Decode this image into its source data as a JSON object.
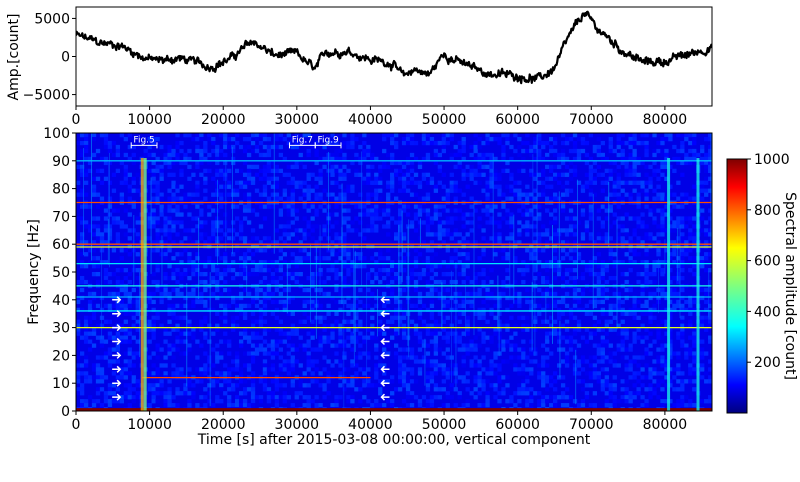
{
  "chart_data": [
    {
      "type": "line",
      "ylabel": "Amp.[count]",
      "xlim": [
        0,
        86400
      ],
      "ylim": [
        -6500,
        6500
      ],
      "x_ticks": [
        0,
        10000,
        20000,
        30000,
        40000,
        50000,
        60000,
        70000,
        80000
      ],
      "y_ticks": [
        -5000,
        0,
        5000
      ],
      "series": [
        {
          "x": [
            0,
            3000,
            6000,
            9000,
            11000,
            14000,
            18000,
            21000,
            24000,
            27000,
            30000,
            32500,
            34000,
            37000,
            40000,
            43000,
            44500,
            46000,
            48000,
            50000,
            53000,
            56000,
            58000,
            61000,
            63000,
            65000,
            67000,
            69000,
            71000,
            74000,
            77000,
            80000,
            83000,
            86400
          ],
          "y": [
            2800,
            1800,
            1500,
            0,
            -600,
            -200,
            -1300,
            -300,
            2000,
            100,
            300,
            -1800,
            600,
            800,
            -400,
            -800,
            -2800,
            -1600,
            -2400,
            400,
            -1200,
            -2200,
            -2400,
            -2600,
            -3000,
            -1500,
            2500,
            5700,
            3500,
            1000,
            -800,
            -600,
            200,
            1300
          ],
          "color": "#000000"
        }
      ]
    },
    {
      "type": "heatmap",
      "title": "",
      "xlabel": "Time [s] after 2015-03-08 00:00:00, vertical component",
      "ylabel": "Frequency [Hz]",
      "xlim": [
        0,
        86400
      ],
      "ylim": [
        0,
        100
      ],
      "x_ticks": [
        0,
        10000,
        20000,
        30000,
        40000,
        50000,
        60000,
        70000,
        80000
      ],
      "y_ticks": [
        0,
        10,
        20,
        30,
        40,
        50,
        60,
        70,
        80,
        90,
        100
      ],
      "colorbar": {
        "label": "Spectral amplitude [count]",
        "min": 0,
        "max": 1000,
        "ticks": [
          200,
          400,
          600,
          800,
          1000
        ],
        "colormap": "jet"
      },
      "horizontal_lines": [
        {
          "freq": 0.5,
          "amplitude": 1000
        },
        {
          "freq": 12,
          "amplitude": 800,
          "x_start": 9000,
          "x_end": 40000
        },
        {
          "freq": 30,
          "amplitude": 600
        },
        {
          "freq": 36,
          "amplitude": 350
        },
        {
          "freq": 41,
          "amplitude": 300
        },
        {
          "freq": 45,
          "amplitude": 400
        },
        {
          "freq": 53,
          "amplitude": 350
        },
        {
          "freq": 59,
          "amplitude": 600
        },
        {
          "freq": 60,
          "amplitude": 800
        },
        {
          "freq": 75,
          "amplitude": 800
        },
        {
          "freq": 90,
          "amplitude": 300
        }
      ],
      "vertical_bands": [
        {
          "x": 9000,
          "amplitude": 700
        },
        {
          "x": 9400,
          "amplitude": 500
        },
        {
          "x": 80500,
          "amplitude": 400
        },
        {
          "x": 84500,
          "amplitude": 400
        }
      ],
      "annotations": [
        {
          "label": "Fig.5",
          "x_start": 7500,
          "x_end": 11000,
          "y": 97
        },
        {
          "label": "Fig.7",
          "x_start": 29000,
          "x_end": 32500,
          "y": 97
        },
        {
          "label": "Fig.9",
          "x_start": 32500,
          "x_end": 36000,
          "y": 97
        }
      ],
      "arrow_freqs": [
        5,
        10,
        15,
        20,
        25,
        30,
        35,
        40
      ]
    }
  ]
}
